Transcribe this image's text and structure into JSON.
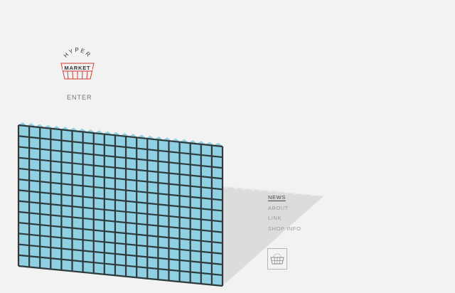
{
  "logo": {
    "arc_text": "HYPER",
    "label": "MARKET",
    "accent_color": "#d23a33",
    "icon": "shopping-basket-logo"
  },
  "enter_label": "ENTER",
  "nav": {
    "items": [
      {
        "label": "NEWS",
        "active": true
      },
      {
        "label": "ABOUT",
        "active": false
      },
      {
        "label": "LINK",
        "active": false
      },
      {
        "label": "SHOP INFO",
        "active": false
      }
    ]
  },
  "cart": {
    "icon": "basket-icon"
  },
  "colors": {
    "background": "#f2f2f2",
    "grid_fill": "#8fd0e2",
    "grid_lines": "#2e3a3c",
    "shadow": "#dcdcdc",
    "text_muted": "#9a9a9a",
    "text_active": "#444444"
  }
}
